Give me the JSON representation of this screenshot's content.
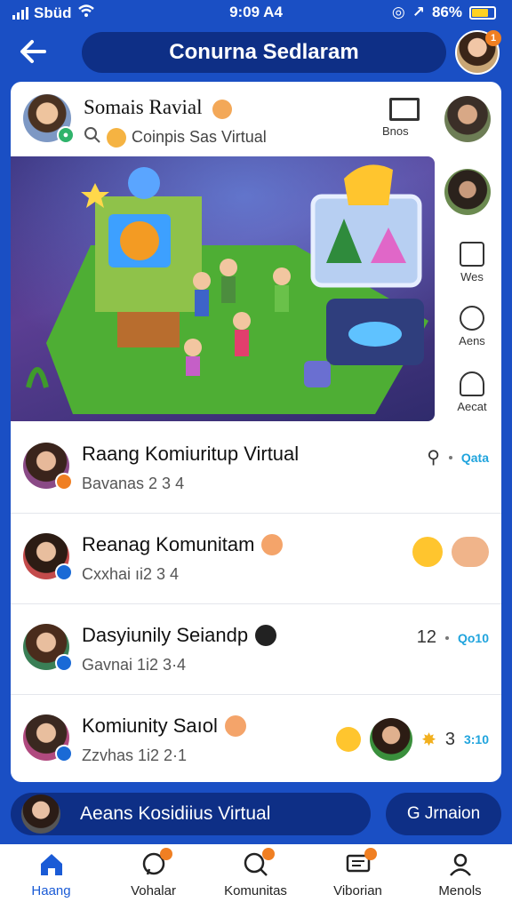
{
  "status": {
    "carrier": "Sbüd",
    "time": "9:09 A4",
    "battery": "86%",
    "colors": {
      "battery": "#ffd21f"
    }
  },
  "header": {
    "title": "Conurna Sedlaram",
    "back_icon": "arrow-left-icon",
    "avatar_badge": "1"
  },
  "post": {
    "name": "Somais Ravial",
    "subtitle": "Coinpis Sas Virtual",
    "box_label": "Bnos"
  },
  "side_actions": [
    {
      "label": "Wes",
      "icon": "document-icon"
    },
    {
      "label": "Aens",
      "icon": "share-icon"
    },
    {
      "label": "Aecat",
      "icon": "person-icon"
    }
  ],
  "list": [
    {
      "title": "Raang Komiuritup Virtual",
      "subtitle": "Bavanas 2 3 4",
      "meta": "",
      "link": "Qata",
      "badge_color": "#f07f22"
    },
    {
      "title": "Reanag Komunitam",
      "subtitle": "Cxxhai ıi2 3 4",
      "meta": "",
      "link": "",
      "badge_color": "#1a6ad6"
    },
    {
      "title": "Dasyiunily Seiandp",
      "subtitle": "Gavnai 1i2 3·4",
      "meta": "12",
      "link": "Qo10",
      "badge_color": "#1a6ad6"
    },
    {
      "title": "Komiunity Saıol",
      "subtitle": "Zzvhas 1i2 2·1",
      "meta": "3",
      "link": "3:10",
      "badge_color": "#1a6ad6"
    }
  ],
  "footer": {
    "pill_text": "Aeans Kosidiius Virtual",
    "action_text": "G Jrnaion"
  },
  "tabs": [
    {
      "label": "Haang",
      "icon": "home-icon",
      "active": true
    },
    {
      "label": "Vohalar",
      "icon": "chat-icon",
      "active": false
    },
    {
      "label": "Komunitas",
      "icon": "search-icon",
      "active": false
    },
    {
      "label": "Viborian",
      "icon": "message-icon",
      "active": false
    },
    {
      "label": "Menols",
      "icon": "profile-icon",
      "active": false
    }
  ]
}
